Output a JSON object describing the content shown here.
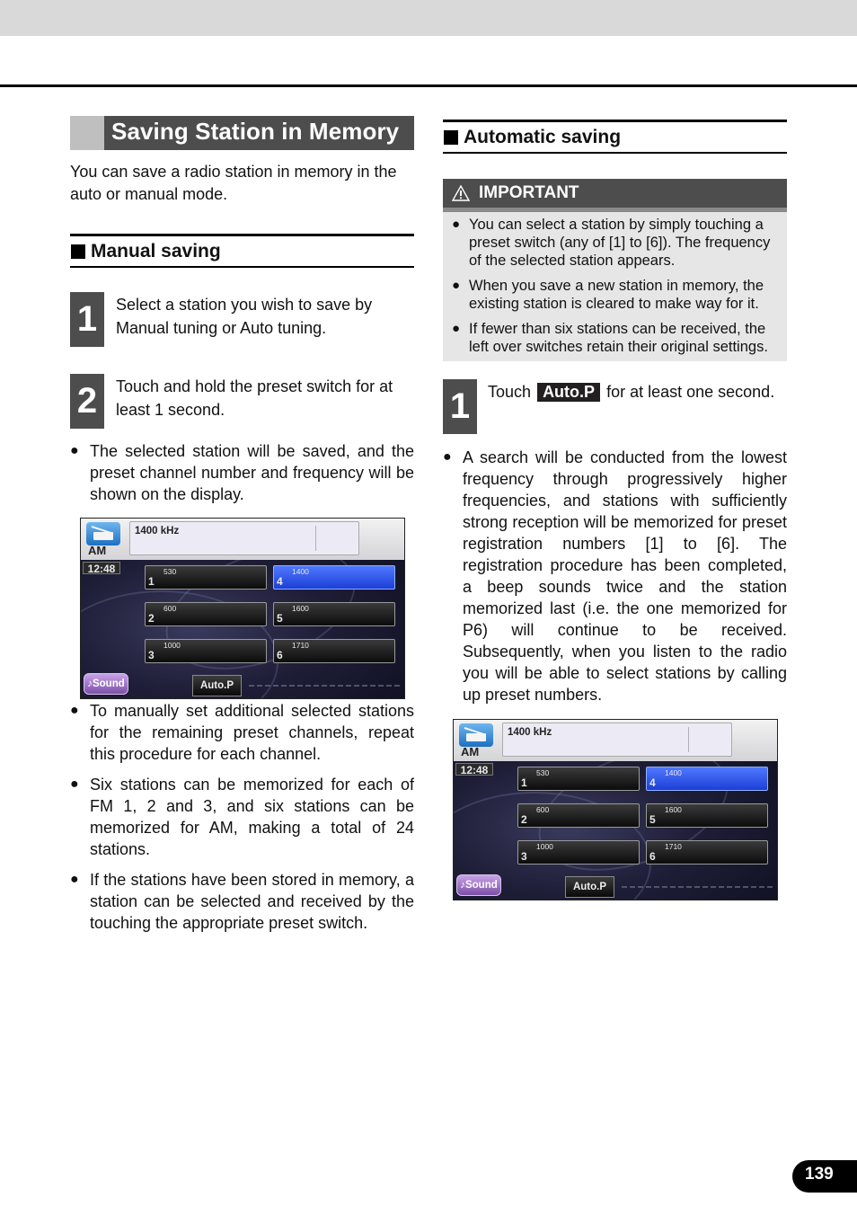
{
  "chapter": {
    "title": "Saving Station in Memory",
    "intro": "You can save a radio station in memory in the auto or manual mode."
  },
  "manual": {
    "heading": "Manual saving",
    "steps": [
      {
        "num": "1",
        "text": "Select a station you wish to save by Manual tuning or Auto tuning."
      },
      {
        "num": "2",
        "text": "Touch and hold the preset switch for at least 1 second."
      }
    ],
    "bullet_after_steps": "The selected station will be saved, and the preset channel number and frequency will be shown on the display.",
    "bullets_after_screen": [
      "To manually set additional selected stations for the remaining preset channels, repeat this procedure for each channel.",
      "Six stations can be memorized for each of FM 1, 2 and 3, and six stations can be memorized for AM, making a total of 24 stations.",
      "If the stations have been stored in memory, a station can be selected and received by the touching the appropriate preset switch."
    ]
  },
  "automatic": {
    "heading": "Automatic saving",
    "important": {
      "icon": "warning-triangle-icon",
      "title": "IMPORTANT",
      "items": [
        "You can select a station by simply touching a preset switch (any of [1] to [6]). The frequency of the selected station appears.",
        "When you save a new station in memory, the existing station is cleared to make way for it.",
        "If fewer than six stations can be received, the left over switches retain their original settings."
      ]
    },
    "step": {
      "num": "1",
      "text_before": "Touch",
      "chip": "Auto.P",
      "text_after": "for at least one second."
    },
    "bullet": "A search will be conducted from the lowest frequency through progressively higher frequencies, and stations with sufficiently strong reception will be memorized for preset registration numbers [1] to [6]. The registration procedure has been completed, a beep sounds twice and the station memorized last (i.e. the one memorized for P6) will continue to be received. Subsequently, when you listen to the radio you will be able to select stations by calling up preset numbers."
  },
  "radio_screen": {
    "band": "AM",
    "band_icon": "radio-band-icon",
    "frequency": "1400 kHz",
    "clock": "12:48",
    "presets": [
      {
        "num": "1",
        "freq": "530",
        "active": false
      },
      {
        "num": "2",
        "freq": "600",
        "active": false
      },
      {
        "num": "3",
        "freq": "1000",
        "active": false
      },
      {
        "num": "4",
        "freq": "1400",
        "active": true
      },
      {
        "num": "5",
        "freq": "1600",
        "active": false
      },
      {
        "num": "6",
        "freq": "1710",
        "active": false
      }
    ],
    "sound_label": "♪Sound",
    "autop_label": "Auto.P",
    "active_color": "#2f55f0"
  },
  "bullet_glyph": "●",
  "page_number": "139"
}
